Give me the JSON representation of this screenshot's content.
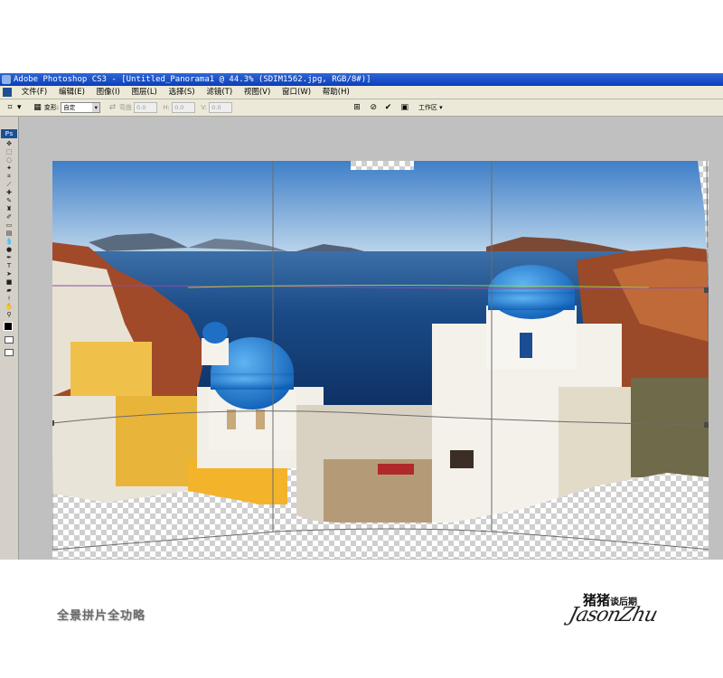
{
  "window": {
    "title": "Adobe Photoshop CS3 - [Untitled_Panorama1 @ 44.3% (SDIM1562.jpg, RGB/8#)]"
  },
  "menu": {
    "items": [
      "文件(F)",
      "编辑(E)",
      "图像(I)",
      "图层(L)",
      "选择(S)",
      "滤镜(T)",
      "视图(V)",
      "窗口(W)",
      "帮助(H)"
    ]
  },
  "options_bar": {
    "transform_label": "变形:",
    "transform_value": "自定",
    "bend_label": "弯曲",
    "bend_value": "0.0",
    "h_label": "H:",
    "h_value": "0.0",
    "v_label": "V:",
    "v_value": "0.0",
    "workspace_label": "工作区 ▾"
  },
  "toolbox": {
    "badge": "Ps"
  },
  "footer": {
    "caption": "全景拼片全功略",
    "brand_big": "猪猪",
    "brand_small": "谈后期",
    "signature": "JasonZhu"
  },
  "colors": {
    "title_bar": "#0b3fb8",
    "chrome": "#ece9d8",
    "workspace": "#c0c0c0",
    "sea": "#0f3a72",
    "dome": "#1f7fd6"
  }
}
